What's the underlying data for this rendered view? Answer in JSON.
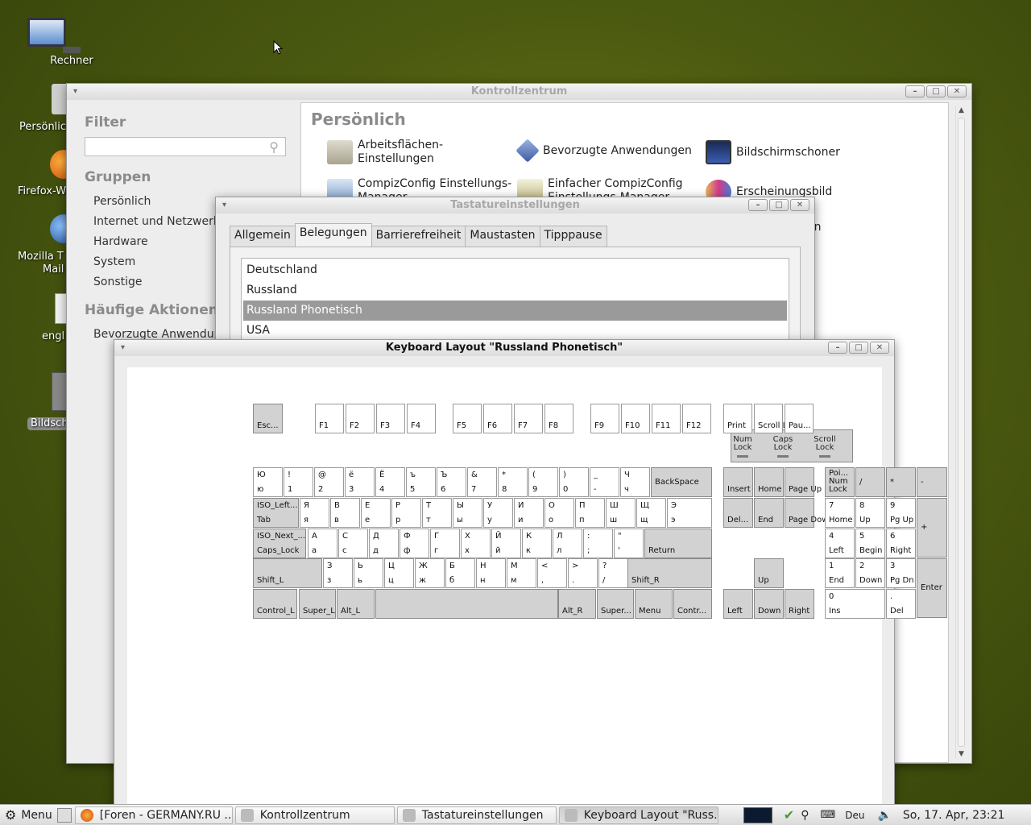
{
  "desktop": {
    "icons": [
      {
        "label": "Rechner"
      },
      {
        "label": "Persönlic"
      },
      {
        "label": "Firefox-W"
      },
      {
        "label": "Mozilla T"
      },
      {
        "label": "Mail"
      },
      {
        "label": "engl"
      },
      {
        "label": "Bildsch"
      }
    ]
  },
  "control_center": {
    "title": "Kontrollzentrum",
    "filter_heading": "Filter",
    "filter_value": "",
    "groups_heading": "Gruppen",
    "groups": [
      "Persönlich",
      "Internet und Netzwerk",
      "Hardware",
      "System",
      "Sonstige"
    ],
    "actions_heading": "Häufige Aktionen",
    "actions": [
      "Bevorzugte Anwendungen"
    ],
    "section_title": "Persönlich",
    "items": {
      "workspace_line1": "Arbeitsflächen-",
      "workspace_line2": "Einstellungen",
      "preferred_apps": "Bevorzugte Anwendungen",
      "screensaver": "Bildschirmschoner",
      "ccsm_line1": "CompizConfig Einstellungs-",
      "ccsm_line2": "Manager",
      "simple_ccsm_line1": "Einfacher CompizConfig",
      "simple_ccsm_line2": "Einstellungs-Manager",
      "appearance": "Erscheinungsbild",
      "partial_1": "en",
      "partial_2": "e"
    }
  },
  "keyboard_settings": {
    "title": "Tastatureinstellungen",
    "tabs": [
      "Allgemein",
      "Belegungen",
      "Barrierefreiheit",
      "Maustasten",
      "Tipppause"
    ],
    "selected_tab": "Belegungen",
    "layouts": [
      "Deutschland",
      "Russland",
      "Russland Phonetisch",
      "USA"
    ],
    "selected_layout": "Russland Phonetisch"
  },
  "keyboard_layout": {
    "title": "Keyboard Layout \"Russland Phonetisch\"",
    "lock_lamps": {
      "num_line1": "Num",
      "num_line2": "Lock",
      "caps_line1": "Caps",
      "caps_line2": "Lock",
      "scroll_line1": "Scroll",
      "scroll_line2": "Lock"
    },
    "fn_row": [
      "Esc...",
      "F1",
      "F2",
      "F3",
      "F4",
      "F5",
      "F6",
      "F7",
      "F8",
      "F9",
      "F10",
      "F11",
      "F12",
      "Print",
      "Scroll Lock",
      "Pau..."
    ],
    "number_row": [
      {
        "top": "Ю",
        "bottom": "ю"
      },
      {
        "top": "!",
        "bottom": "1"
      },
      {
        "top": "@",
        "bottom": "2"
      },
      {
        "top": "ё",
        "bottom": "3"
      },
      {
        "top": "Ё",
        "bottom": "4"
      },
      {
        "top": "ъ",
        "bottom": "5"
      },
      {
        "top": "Ъ",
        "bottom": "6"
      },
      {
        "top": "&",
        "bottom": "7"
      },
      {
        "top": "*",
        "bottom": "8"
      },
      {
        "top": "(",
        "bottom": "9"
      },
      {
        "top": ")",
        "bottom": "0"
      },
      {
        "top": "_",
        "bottom": "-"
      },
      {
        "top": "Ч",
        "bottom": "ч"
      }
    ],
    "backspace": "BackSpace",
    "tab_key": {
      "top": "ISO_Left...",
      "bottom": "Tab"
    },
    "q_row": [
      {
        "top": "Я",
        "bottom": "я"
      },
      {
        "top": "В",
        "bottom": "в"
      },
      {
        "top": "Е",
        "bottom": "е"
      },
      {
        "top": "Р",
        "bottom": "р"
      },
      {
        "top": "Т",
        "bottom": "т"
      },
      {
        "top": "Ы",
        "bottom": "ы"
      },
      {
        "top": "У",
        "bottom": "у"
      },
      {
        "top": "И",
        "bottom": "и"
      },
      {
        "top": "О",
        "bottom": "о"
      },
      {
        "top": "П",
        "bottom": "п"
      },
      {
        "top": "Ш",
        "bottom": "ш"
      },
      {
        "top": "Щ",
        "bottom": "щ"
      },
      {
        "top": "Э",
        "bottom": "э"
      }
    ],
    "caps_key": {
      "top": "ISO_Next_...",
      "bottom": "Caps_Lock"
    },
    "a_row": [
      {
        "top": "А",
        "bottom": "а"
      },
      {
        "top": "С",
        "bottom": "с"
      },
      {
        "top": "Д",
        "bottom": "д"
      },
      {
        "top": "Ф",
        "bottom": "ф"
      },
      {
        "top": "Г",
        "bottom": "г"
      },
      {
        "top": "Х",
        "bottom": "х"
      },
      {
        "top": "Й",
        "bottom": "й"
      },
      {
        "top": "К",
        "bottom": "к"
      },
      {
        "top": "Л",
        "bottom": "л"
      },
      {
        "top": ":",
        "bottom": ";"
      },
      {
        "top": "\"",
        "bottom": "'"
      }
    ],
    "return": "Return",
    "shift_l": "Shift_L",
    "z_row": [
      {
        "top": "З",
        "bottom": "з"
      },
      {
        "top": "Ь",
        "bottom": "ь"
      },
      {
        "top": "Ц",
        "bottom": "ц"
      },
      {
        "top": "Ж",
        "bottom": "ж"
      },
      {
        "top": "Б",
        "bottom": "б"
      },
      {
        "top": "Н",
        "bottom": "н"
      },
      {
        "top": "М",
        "bottom": "м"
      },
      {
        "top": "<",
        "bottom": ","
      },
      {
        "top": ">",
        "bottom": "."
      },
      {
        "top": "?",
        "bottom": "/"
      }
    ],
    "shift_r": "Shift_R",
    "bottom_row": [
      "Control_L",
      "Super_L",
      "Alt_L",
      "",
      "Alt_R",
      "Super...",
      "Menu",
      "Contr..."
    ],
    "nav": [
      "Insert",
      "Home",
      "Page Up",
      "Del...",
      "End",
      "Page Down"
    ],
    "arrows": [
      "Up",
      "Left",
      "Down",
      "Right"
    ],
    "numpad": {
      "numlock_line1": "Poi...",
      "numlock_line2": "Num",
      "numlock_line3": "Lock",
      "div": "/",
      "mul": "*",
      "sub": "-",
      "add": "+",
      "enter": "Enter",
      "k7": {
        "top": "7",
        "bottom": "Home"
      },
      "k8": {
        "top": "8",
        "bottom": "Up"
      },
      "k9": {
        "top": "9",
        "bottom": "Pg Up"
      },
      "k4": {
        "top": "4",
        "bottom": "Left"
      },
      "k5": {
        "top": "5",
        "bottom": "Begin"
      },
      "k6": {
        "top": "6",
        "bottom": "Right"
      },
      "k1": {
        "top": "1",
        "bottom": "End"
      },
      "k2": {
        "top": "2",
        "bottom": "Down"
      },
      "k3": {
        "top": "3",
        "bottom": "Pg Dn"
      },
      "k0": {
        "top": "0",
        "bottom": "Ins"
      },
      "kdot": {
        "top": ".",
        "bottom": "Del"
      }
    }
  },
  "taskbar": {
    "menu_label": "Menu",
    "tasks": [
      "[Foren - GERMANY.RU ...",
      "Kontrollzentrum",
      "Tastatureinstellungen",
      "Keyboard Layout \"Russ..."
    ],
    "keyboard_indicator": "Deu",
    "clock": "So, 17. Apr, 23:21"
  }
}
